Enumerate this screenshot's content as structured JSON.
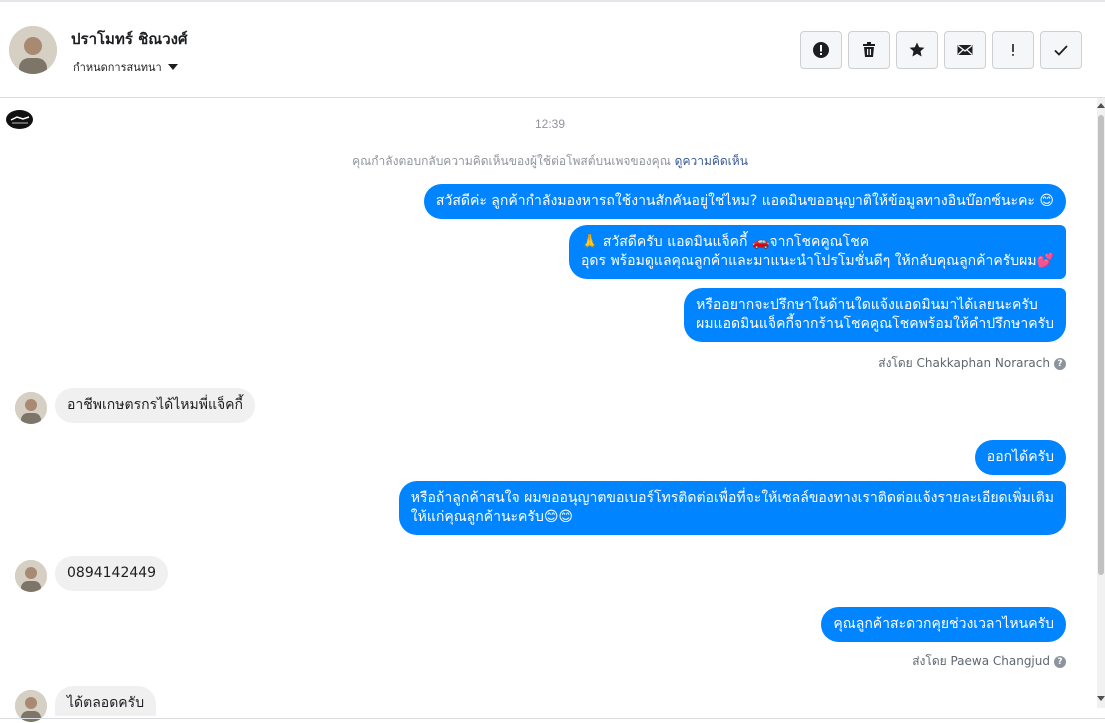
{
  "header": {
    "name": "ปราโมทร์ ชิณวงศ์",
    "assign_label": "กำหนดการสนทนา",
    "actions": [
      {
        "icon": "alert-circle-icon",
        "name": "mark-spam-button"
      },
      {
        "icon": "trash-icon",
        "name": "delete-button"
      },
      {
        "icon": "star-icon",
        "name": "star-button"
      },
      {
        "icon": "envelope-icon",
        "name": "mark-unread-button"
      },
      {
        "icon": "exclamation-icon",
        "name": "follow-up-button"
      },
      {
        "icon": "check-icon",
        "name": "mark-done-button"
      }
    ]
  },
  "chat": {
    "time": "12:39",
    "reply_note": "คุณกำลังตอบกลับความคิดเห็นของผู้ใช้ต่อโพสต์บนเพจของคุณ",
    "reply_link": "ดูความคิดเห็น",
    "msg1": "สวัสดีค่ะ ลูกค้ากำลังมองหารถใช้งานสักคันอยู่ใช่ไหม? แอดมินขออนุญาติให้ข้อมูลทางอินบ๊อกซ์นะคะ 😊",
    "msg2_line1": "🙏 สวัสดีครับ แอดมินแจ็คกี้ 🚗จากโชคคูณโชค",
    "msg2_line2": "อุดร พร้อมดูแลคุณลูกค้าและมาแนะนำโปรโมชั่นดีๆ ให้กลับคุณลูกค้าครับผม💕",
    "msg3_line1": "หรืออยากจะปรึกษาในด้านใดแจ้งแอดมินมาได้เลยนะครับ",
    "msg3_line2": "ผมแอดมินแจ็คกี้จากร้านโชคคูณโชคพร้อมให้คำปรึกษาครับ",
    "sent_by_1": "ส่งโดย Chakkaphan Norarach",
    "in1": "อาชีพเกษตรกรได้ไหมพี่แจ็คกี้",
    "msg4": "ออกได้ครับ",
    "msg5_line1": "หรือถ้าลูกค้าสนใจ ผมขออนุญาตขอเบอร์โทรติดต่อเพื่อที่จะให้เซลล์ของทางเราติดต่อแจ้งรายละเอียดเพิ่มเติม",
    "msg5_line2": "ให้แก่คุณลูกค้านะครับ😊😊",
    "in2": "0894142449",
    "msg6": "คุณลูกค้าสะดวกคุยช่วงเวลาไหนครับ",
    "sent_by_2": "ส่งโดย Paewa Changjud",
    "in3": "ได้ตลอดครับ"
  },
  "colors": {
    "outgoing_bubble": "#0084ff",
    "incoming_bubble": "#f1f0f0",
    "link": "#385898"
  }
}
